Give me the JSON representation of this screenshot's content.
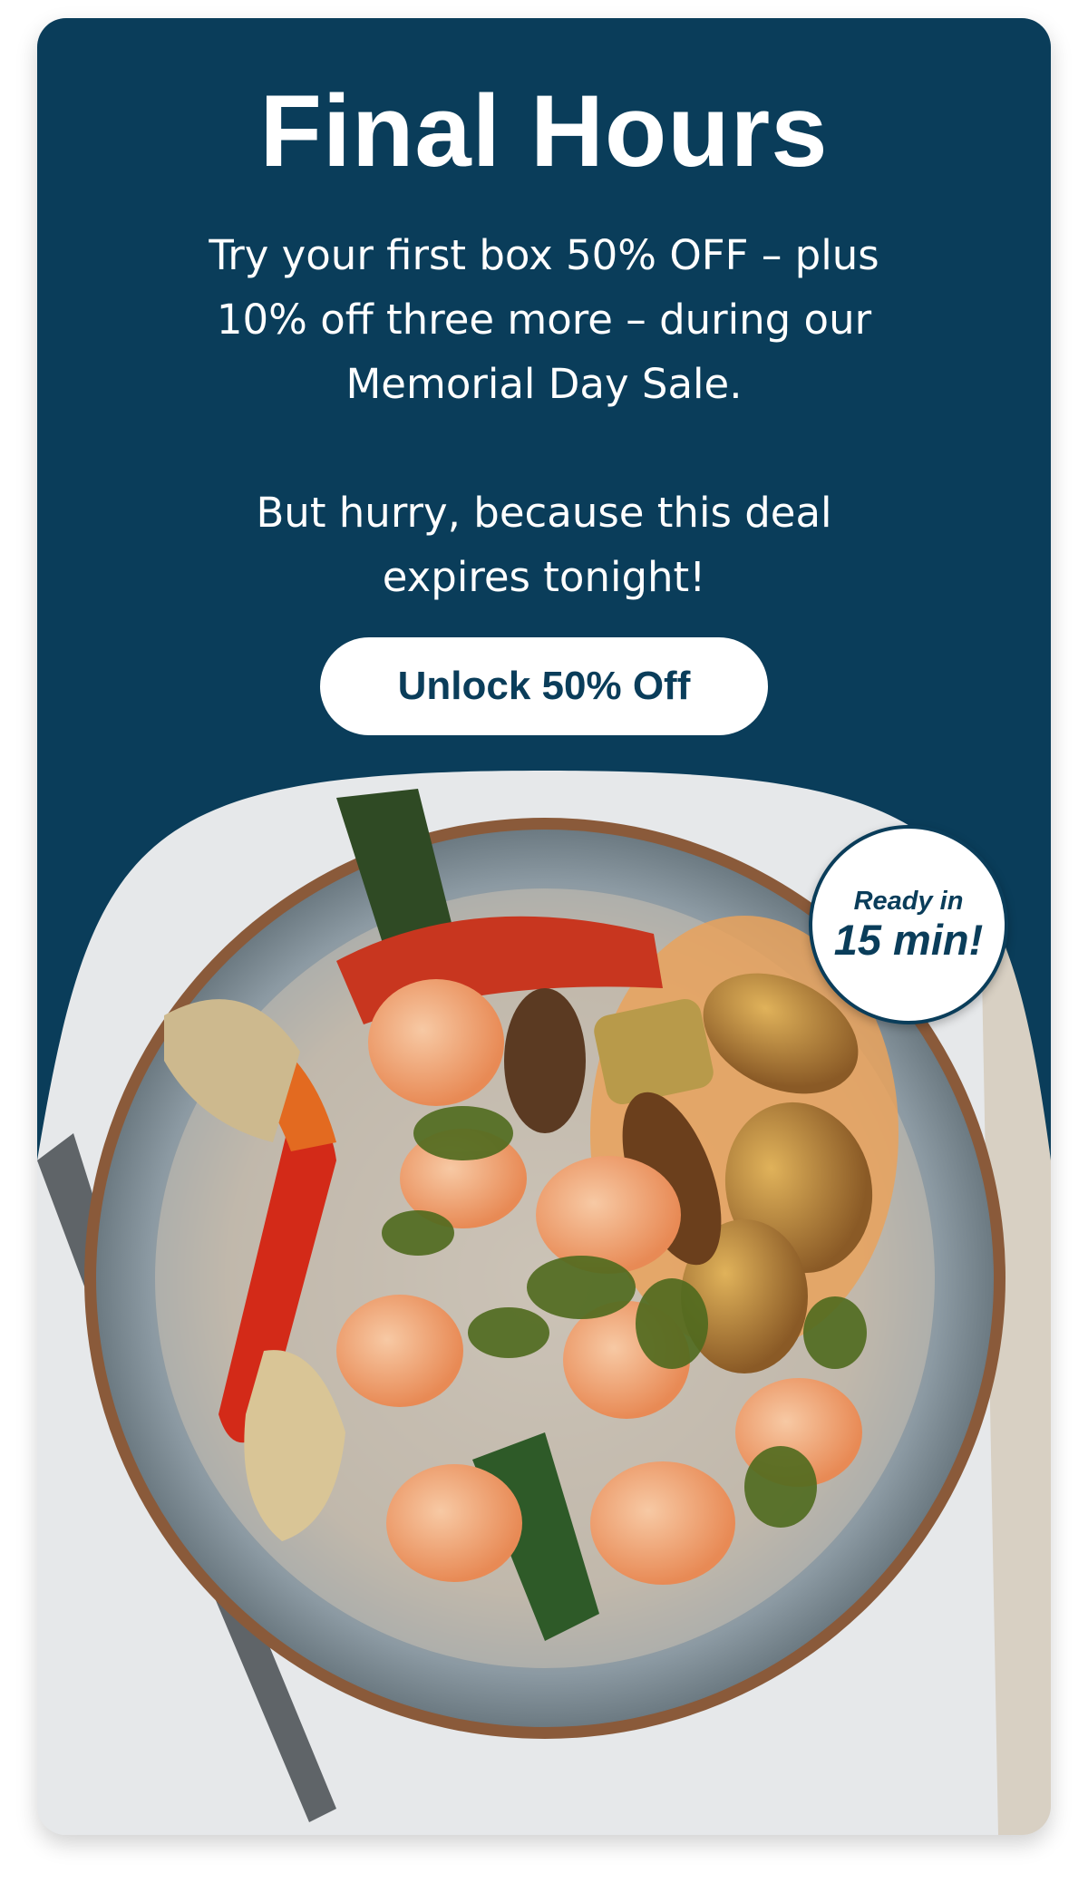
{
  "promo": {
    "title": "Final Hours",
    "paragraph_1": "Try your first box 50% OFF – plus 10% off three more – during our Memorial Day Sale.",
    "paragraph_2": "But hurry, because this deal expires tonight!",
    "cta_label": "Unlock 50% Off"
  },
  "badge": {
    "line_1": "Ready in",
    "line_2": "15 min!"
  },
  "photo": {
    "icon": "plated-shrimp-meal-image"
  },
  "colors": {
    "hero_bg": "#0a3d5a",
    "cta_bg": "#ffffff",
    "cta_text": "#0a3d5a",
    "text": "#ffffff"
  }
}
